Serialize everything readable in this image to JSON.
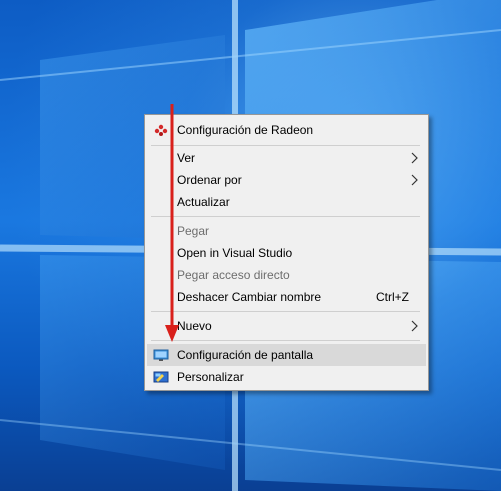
{
  "menu": {
    "items": [
      {
        "label": "Configuración de Radeon",
        "icon": "radeon-icon"
      },
      {
        "label": "Ver",
        "submenu": true
      },
      {
        "label": "Ordenar por",
        "submenu": true
      },
      {
        "label": "Actualizar"
      },
      {
        "label": "Pegar",
        "disabled": true
      },
      {
        "label": "Open in Visual Studio"
      },
      {
        "label": "Pegar acceso directo",
        "disabled": true
      },
      {
        "label": "Deshacer Cambiar nombre",
        "shortcut": "Ctrl+Z"
      },
      {
        "label": "Nuevo",
        "submenu": true
      },
      {
        "label": "Configuración de pantalla",
        "icon": "display-icon",
        "highlighted": true
      },
      {
        "label": "Personalizar",
        "icon": "personalize-icon"
      }
    ]
  },
  "annotation": {
    "color": "#d9201b",
    "icon": "red-arrow"
  },
  "colors": {
    "desktop_blue": "#1a78e0",
    "menu_bg": "#f0f0f0",
    "highlight_bg": "#d9d9d9",
    "disabled_text": "#6d6d6d"
  }
}
